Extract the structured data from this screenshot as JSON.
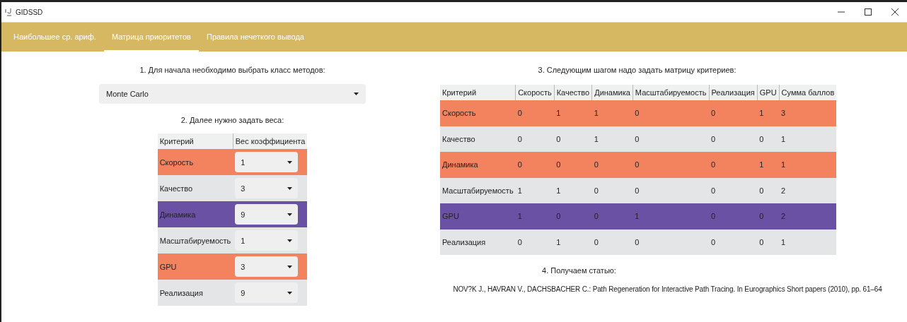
{
  "window": {
    "title": "GIDSSD"
  },
  "tabs": [
    {
      "label": "Наибольшее ср. ариф.",
      "selected": false
    },
    {
      "label": "Матрица приоритетов",
      "selected": true
    },
    {
      "label": "Правила нечеткого вывода",
      "selected": false
    }
  ],
  "step1": {
    "label": "1. Для начала необходимо выбрать класс методов:",
    "method_select": {
      "value": "Monte Carlo"
    }
  },
  "step2": {
    "label": "2. Далее нужно задать веса:",
    "table": {
      "columns": [
        "Критерий",
        "Вес коэффициента"
      ],
      "rows": [
        {
          "criterion": "Скорость",
          "weight": "1",
          "color": "#f3825f"
        },
        {
          "criterion": "Качество",
          "weight": "3",
          "color": "#e4e5e7"
        },
        {
          "criterion": "Динамика",
          "weight": "9",
          "color": "#6a51a3"
        },
        {
          "criterion": "Масштабируемость",
          "weight": "1",
          "color": "#e4e5e7"
        },
        {
          "criterion": "GPU",
          "weight": "3",
          "color": "#f3825f"
        },
        {
          "criterion": "Реализация",
          "weight": "9",
          "color": "#e4e5e7"
        }
      ]
    }
  },
  "step3": {
    "label": "3. Следующим шагом надо задать матрицу критериев:",
    "table": {
      "columns": [
        "Критерий",
        "Скорость",
        "Качество",
        "Динамика",
        "Масштабируемость",
        "Реализация",
        "GPU",
        "Сумма баллов"
      ],
      "rows": [
        {
          "cells": [
            "Скорость",
            "0",
            "1",
            "1",
            "0",
            "0",
            "1",
            "3"
          ],
          "color": "#f3825f"
        },
        {
          "cells": [
            "Качество",
            "0",
            "0",
            "1",
            "0",
            "0",
            "0",
            "1"
          ],
          "color": "#e4e5e7"
        },
        {
          "cells": [
            "Динамика",
            "0",
            "0",
            "0",
            "0",
            "0",
            "1",
            "1"
          ],
          "color": "#f3825f"
        },
        {
          "cells": [
            "Масштабируемость",
            "1",
            "1",
            "0",
            "0",
            "0",
            "0",
            "2"
          ],
          "color": "#e4e5e7"
        },
        {
          "cells": [
            "GPU",
            "1",
            "0",
            "0",
            "1",
            "0",
            "0",
            "2"
          ],
          "color": "#6a51a3"
        },
        {
          "cells": [
            "Реализация",
            "0",
            "1",
            "0",
            "0",
            "0",
            "0",
            "1"
          ],
          "color": "#e4e5e7"
        }
      ]
    }
  },
  "step4": {
    "label": "4. Получаем статью:",
    "article": "NOV?K J., HAVRAN V., DACHSBACHER C.: Path Regeneration for Interactive Path Tracing. In Eurographics Short papers (2010), pp. 61–64"
  }
}
